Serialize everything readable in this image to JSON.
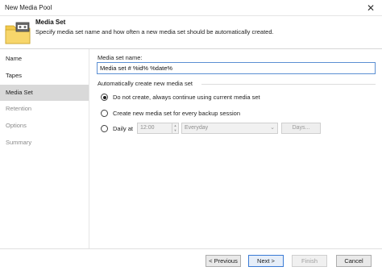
{
  "window": {
    "title": "New Media Pool",
    "close_glyph": "✕"
  },
  "header": {
    "title": "Media Set",
    "description": "Specify media set name and how often a new media set should be automatically created.",
    "icon": "media-pool-folder-icon"
  },
  "sidebar": {
    "items": [
      {
        "label": "Name",
        "state": "normal"
      },
      {
        "label": "Tapes",
        "state": "normal"
      },
      {
        "label": "Media Set",
        "state": "active"
      },
      {
        "label": "Retention",
        "state": "disabled"
      },
      {
        "label": "Options",
        "state": "disabled"
      },
      {
        "label": "Summary",
        "state": "disabled"
      }
    ]
  },
  "form": {
    "media_set_name_label": "Media set name:",
    "media_set_name_value": "Media set # %id% %date%",
    "auto_create_group_label": "Automatically create new media set",
    "options": [
      {
        "label": "Do not create, always continue using current media set",
        "checked": true
      },
      {
        "label": "Create new media set for every backup session",
        "checked": false
      },
      {
        "label": "Daily at",
        "checked": false
      }
    ],
    "daily_time": "12:00",
    "daily_frequency": "Everyday",
    "days_button": "Days..."
  },
  "footer": {
    "previous": "< Previous",
    "next": "Next >",
    "finish": "Finish",
    "cancel": "Cancel"
  }
}
